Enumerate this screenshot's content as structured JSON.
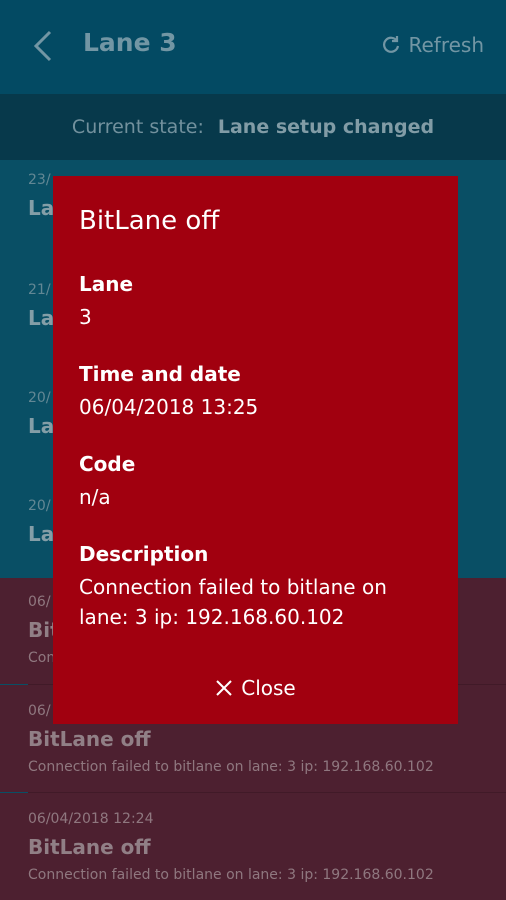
{
  "header": {
    "title": "Lane 3",
    "refresh_label": "Refresh"
  },
  "status": {
    "label": "Current state:",
    "value": "Lane setup changed"
  },
  "events": [
    {
      "date": "23/",
      "title": "La",
      "desc": ""
    },
    {
      "date": "21/",
      "title": "La",
      "desc": ""
    },
    {
      "date": "20/",
      "title": "La",
      "desc": ""
    },
    {
      "date": "20/",
      "title": "La",
      "desc": ""
    },
    {
      "date": "06/",
      "title": "Bit",
      "desc": "Con"
    },
    {
      "date": "06/",
      "title": "BitLane off",
      "desc": "Connection failed to bitlane on lane: 3 ip: 192.168.60.102"
    },
    {
      "date": "06/04/2018 12:24",
      "title": "BitLane off",
      "desc": "Connection failed to bitlane on lane: 3 ip: 192.168.60.102"
    }
  ],
  "dialog": {
    "title": "BitLane off",
    "lane_label": "Lane",
    "lane_value": "3",
    "time_label": "Time and date",
    "time_value": "06/04/2018 13:25",
    "code_label": "Code",
    "code_value": "n/a",
    "desc_label": "Description",
    "desc_value": "Connection failed to bitlane on lane: 3 ip: 192.168.60.102",
    "close_label": "Close"
  }
}
